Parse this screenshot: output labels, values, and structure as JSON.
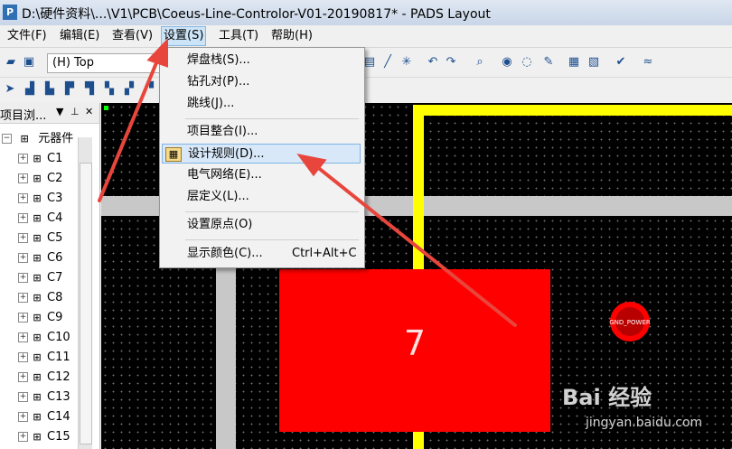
{
  "window": {
    "title": "D:\\硬件资料\\...\\V1\\PCB\\Coeus-Line-Controlor-V01-20190817* - PADS Layout"
  },
  "menubar": {
    "items": [
      "文件(F)",
      "编辑(E)",
      "查看(V)",
      "设置(S)",
      "工具(T)",
      "帮助(H)"
    ]
  },
  "toolbar": {
    "layer": "(H) Top"
  },
  "project_panel": {
    "title": "项目浏...",
    "root_label": "元器件",
    "components": [
      "C1",
      "C2",
      "C3",
      "C4",
      "C5",
      "C6",
      "C7",
      "C8",
      "C9",
      "C10",
      "C11",
      "C12",
      "C13",
      "C14",
      "C15"
    ]
  },
  "settings_menu": {
    "items": [
      {
        "label": "焊盘栈(S)..."
      },
      {
        "label": "钻孔对(P)..."
      },
      {
        "label": "跳线(J)..."
      },
      {
        "label": "项目整合(I)..."
      },
      {
        "label": "设计规则(D)...",
        "highlighted": true
      },
      {
        "label": "电气网络(E)..."
      },
      {
        "label": "层定义(L)..."
      },
      {
        "label": "设置原点(O)"
      },
      {
        "label": "显示颜色(C)...",
        "shortcut": "Ctrl+Alt+C"
      }
    ]
  },
  "canvas": {
    "pad_number": "7",
    "via_net": "GND_POWER"
  },
  "watermark": {
    "text": "Bai 经验",
    "url": "jingyan.baidu.com"
  },
  "colors": {
    "board_outline": "#ffff00",
    "pad": "#ff0000",
    "trace": "#c8c8c8",
    "background": "#000000",
    "arrow": "#e8463c"
  }
}
